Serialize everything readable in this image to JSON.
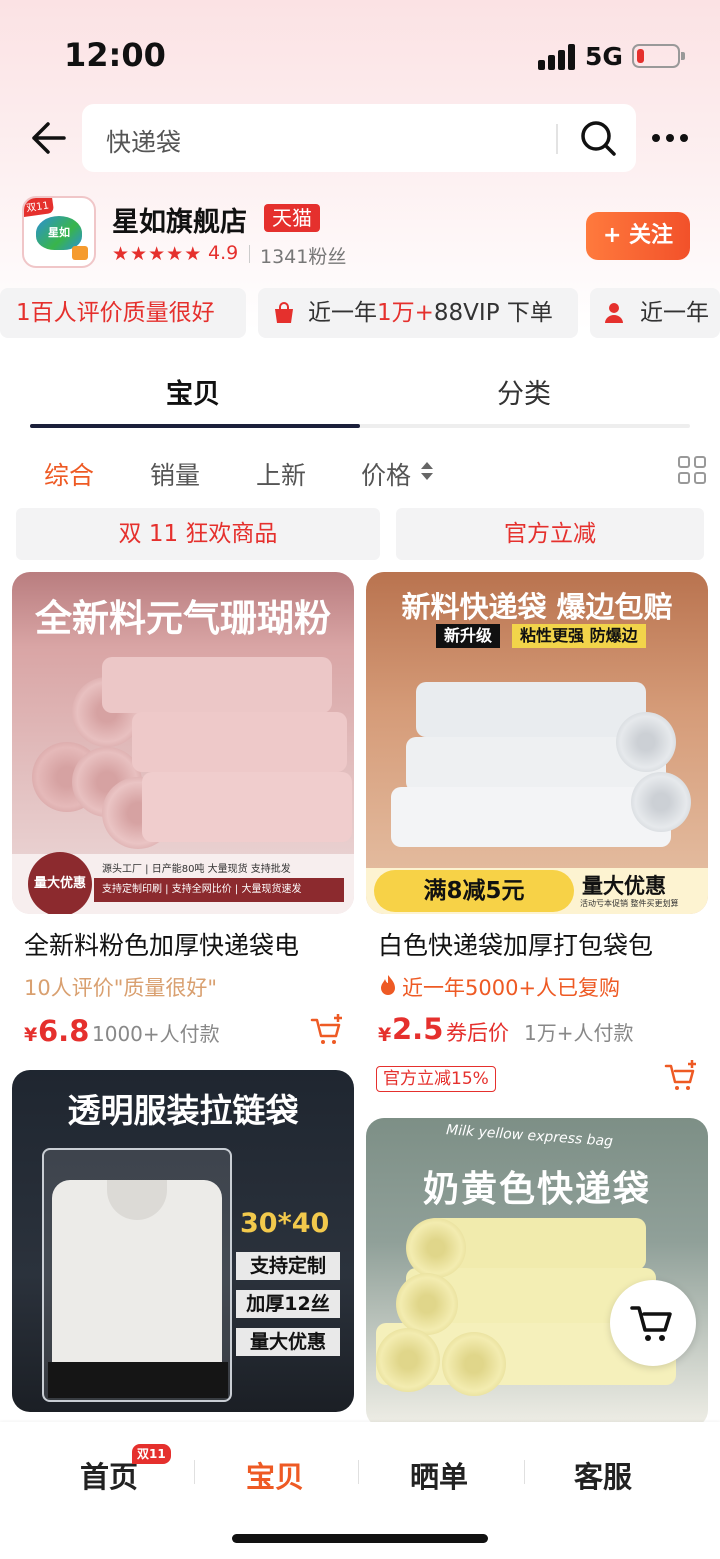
{
  "status": {
    "time": "12:00",
    "network": "5G"
  },
  "search": {
    "query": "快递袋"
  },
  "store": {
    "logo_badge": "双11",
    "logo_text": "星如",
    "name": "星如旗舰店",
    "tag": "天猫",
    "rating": "4.9",
    "fans": "1341粉丝",
    "follow_label": "+ 关注"
  },
  "highlights": {
    "h1_a": "1百人评价",
    "h1_b": "质量很好",
    "h2_a": "近一年",
    "h2_b": "1万+",
    "h2_c": "88VIP 下单",
    "h3_a": "近一年"
  },
  "tabs": [
    {
      "label": "宝贝"
    },
    {
      "label": "分类"
    }
  ],
  "sort": {
    "zonghe": "综合",
    "xiaoliang": "销量",
    "shangxin": "上新",
    "jiage": "价格"
  },
  "promos": [
    {
      "label": "双 11 狂欢商品"
    },
    {
      "label": "官方立减"
    }
  ],
  "products": [
    {
      "image_title": "全新料元气珊瑚粉",
      "image_badge": "量大优惠",
      "image_line1": "源头工厂 | 日产能80吨 大量现货 支持批发",
      "image_line2": "支持定制印刷 | 支持全网比价 | 大量现货速发",
      "title": "全新料粉色加厚快递袋电",
      "subtitle": "10人评价\"质量很好\"",
      "currency": "¥",
      "price": "6.8",
      "sold": "1000+人付款"
    },
    {
      "image_title": "新料快递袋 爆边包赔",
      "image_tag1": "新升级",
      "image_tag2": "粘性更强 防爆边",
      "image_banner": "满8减5元",
      "image_banner_right": "量大优惠",
      "image_banner_small": "活动亏本促销 整件买更划算",
      "title": "白色快递袋加厚打包袋包",
      "subtitle": "近一年5000+人已复购",
      "currency": "¥",
      "price": "2.5",
      "price_note": "券后价",
      "sold": "1万+人付款",
      "tag": "官方立减15%"
    },
    {
      "image_title": "透明服装拉链袋",
      "image_size": "30*40",
      "image_tags": [
        "支持定制",
        "加厚12丝",
        "量大优惠"
      ]
    },
    {
      "image_subtitle": "Milk yellow express bag",
      "image_title": "奶黄色快递袋"
    }
  ],
  "bottom_nav": [
    {
      "label": "首页",
      "badge": "双11"
    },
    {
      "label": "宝贝"
    },
    {
      "label": "晒单"
    },
    {
      "label": "客服"
    }
  ],
  "colors": {
    "accent": "#ee5a24",
    "brand_red": "#e5302d",
    "follow_orange": "#f2512a"
  }
}
